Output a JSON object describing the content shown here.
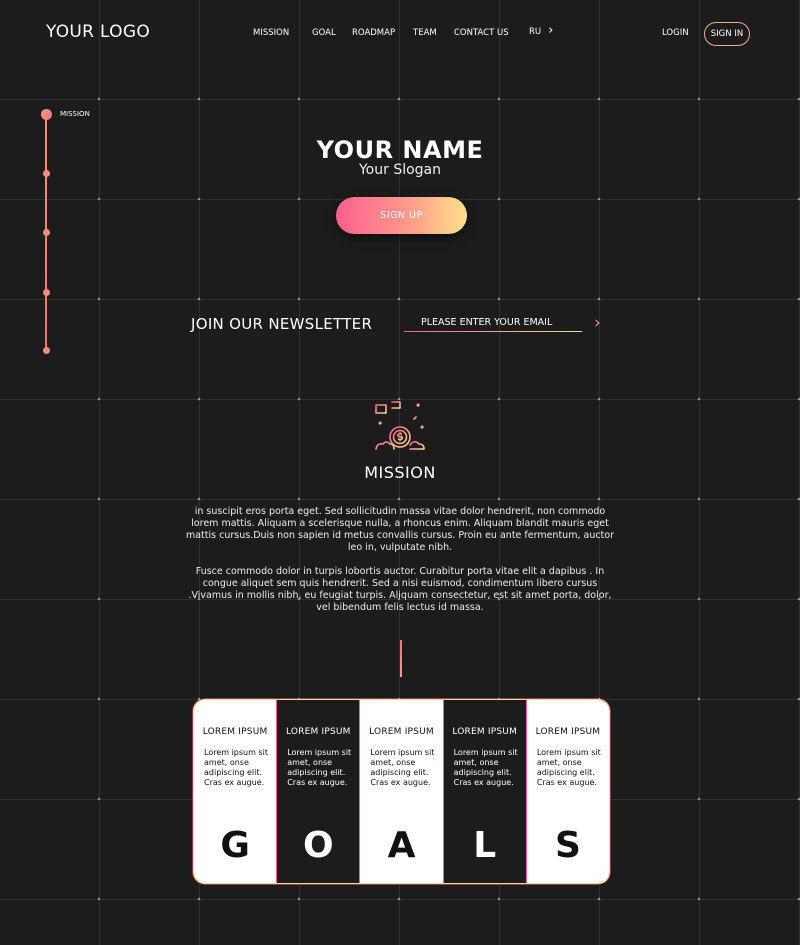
{
  "header": {
    "logo": "YOUR LOGO",
    "nav": [
      "MISSION",
      "GOAL",
      "ROADMAP",
      "TEAM",
      "CONTACT US"
    ],
    "language": "RU",
    "login": "LOGIN",
    "signin": "SIGN IN"
  },
  "timeline": {
    "active_label": "MISSION"
  },
  "hero": {
    "name": "YOUR NAME",
    "slogan": "Your Slogan",
    "signup": "SIGN UP"
  },
  "newsletter": {
    "title": "JOIN OUR NEWSLETTER",
    "placeholder": "PLEASE ENTER YOUR EMAIL"
  },
  "mission": {
    "title": "MISSION",
    "paragraph1": "in suscipit eros porta eget. Sed sollicitudin massa vitae dolor hendrerit, non commodo lorem mattis. Aliquam a scelerisque nulla, a rhoncus enim. Aliquam blandit mauris eget mattis cursus.Duis non sapien id metus convallis cursus. Proin eu ante fermentum, auctor leo in, vulputate nibh.",
    "paragraph2": "Fusce commodo dolor in turpis lobortis auctor. Curabitur porta vitae elit a dapibus . In congue aliquet sem quis hendrerit. Sed a nisi euismod, condimentum libero cursus .Vivamus in mollis nibh, eu feugiat turpis. Aliquam consectetur, est sit amet porta, dolor, vel bibendum felis lectus id massa."
  },
  "goals": [
    {
      "title": "LOREM IPSUM",
      "desc": "Lorem ipsum sit amet, onse adipiscing elit. Cras ex augue.",
      "letter": "G"
    },
    {
      "title": "LOREM IPSUM",
      "desc": "Lorem ipsum sit amet, onse adipiscing elit. Cras ex augue.",
      "letter": "O"
    },
    {
      "title": "LOREM IPSUM",
      "desc": "Lorem ipsum sit amet, onse adipiscing elit. Cras ex augue.",
      "letter": "A"
    },
    {
      "title": "LOREM IPSUM",
      "desc": "Lorem ipsum sit amet, onse adipiscing elit. Cras ex augue.",
      "letter": "L"
    },
    {
      "title": "LOREM IPSUM",
      "desc": "Lorem ipsum sit amet, onse adipiscing elit. Cras ex augue.",
      "letter": "S"
    }
  ],
  "colors": {
    "background": "#1c1c1c",
    "accent_pink": "#ff5f8f",
    "accent_coral": "#ff8a7a",
    "accent_yellow": "#ffd98a"
  },
  "icons": [
    "chevron-right-icon",
    "arrow-right-icon",
    "mission-flag-coin-icon"
  ]
}
